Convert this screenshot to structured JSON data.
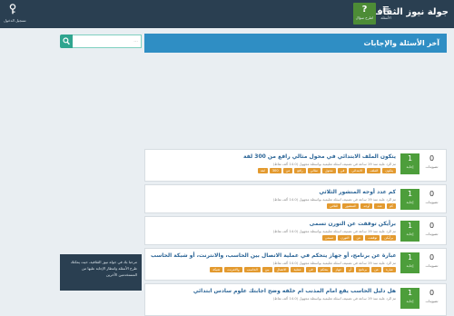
{
  "header": {
    "site_title": "جولة نيوز الثقافية",
    "nav_qa": "الأسئلة",
    "nav_ask": "اطرح سؤال",
    "nav_login": "تسجيل الدخول",
    "qa_icon": "menu-lines-icon",
    "ask_icon": "question-mark-icon",
    "login_icon": "key-icon"
  },
  "search": {
    "placeholder": "..."
  },
  "page_title": "آخر الأسئلة والإجابات",
  "questions": [
    {
      "votes": "0",
      "votes_label": "تصويتات",
      "answers": "1",
      "answers_label": "إجابة",
      "title": "يتكون الملف الابتدائي في محول مثالي رافع من 300 لفة",
      "meta": "تم الرد عليه منذ 19 ساعة في تصنيف اسئلة تعليمية بواسطة مجهول (14.0 ألف نقاط)",
      "tags": [
        "يتكون",
        "الملف",
        "الابتدائي",
        "في",
        "محول",
        "مثالي",
        "رافع",
        "من",
        "300",
        "لفة"
      ]
    },
    {
      "votes": "0",
      "votes_label": "تصويتات",
      "answers": "1",
      "answers_label": "إجابة",
      "title": "كم عدد أوجه المنشور الثلاثي",
      "meta": "تم الرد عليه منذ 19 ساعة في تصنيف اسئلة تعليمية بواسطة مجهول (14.0 ألف نقاط)",
      "tags": [
        "كم",
        "عدد",
        "أوجه",
        "المنشور",
        "الثلاثي"
      ]
    },
    {
      "votes": "0",
      "votes_label": "تصويتات",
      "answers": "1",
      "answers_label": "إجابة",
      "title": "برأيكن توقفت عن التورن تسمى",
      "meta": "تم الرد عليه منذ 19 ساعة في تصنيف اسئلة تعليمية بواسطة مجهول (14.0 ألف نقاط)",
      "tags": [
        "برأيكن",
        "توقفت",
        "عن",
        "التورن",
        "تسمى"
      ]
    },
    {
      "votes": "0",
      "votes_label": "تصويتات",
      "answers": "1",
      "answers_label": "إجابة",
      "title": "عبارة عن برنامج، أو جهاز يتحكم في عملية الاتصال بين الحاسب، والانترنت، أو شبكة الحاسب",
      "meta": "تم الرد عليه منذ 19 ساعة في تصنيف اسئلة تعليمية بواسطة مجهول (14.0 ألف نقاط)",
      "tags": [
        "عبارة",
        "عن",
        "برنامج",
        "أو",
        "جهاز",
        "يتحكم",
        "في",
        "عملية",
        "الاتصال",
        "بين",
        "الحاسب",
        "والانترنت",
        "شبكة"
      ]
    },
    {
      "votes": "0",
      "votes_label": "تصويتات",
      "answers": "1",
      "answers_label": "إجابة",
      "title": "هل دليل الحاسب يقع امام المذنب ام خلفه وضح اجابتك علوم سادس ابتدائي",
      "meta": "تم الرد عليه منذ 19 ساعة في تصنيف اسئلة تعليمية بواسطة مجهول (14.0 ألف نقاط)",
      "tags": []
    }
  ],
  "welcome": {
    "text": "مرحبا بك في جولة نيوز الثقافية، حيث يمكنك طرح الأسئلة وانتظار الإجابة عليها من المستخدمين الآخرين"
  }
}
